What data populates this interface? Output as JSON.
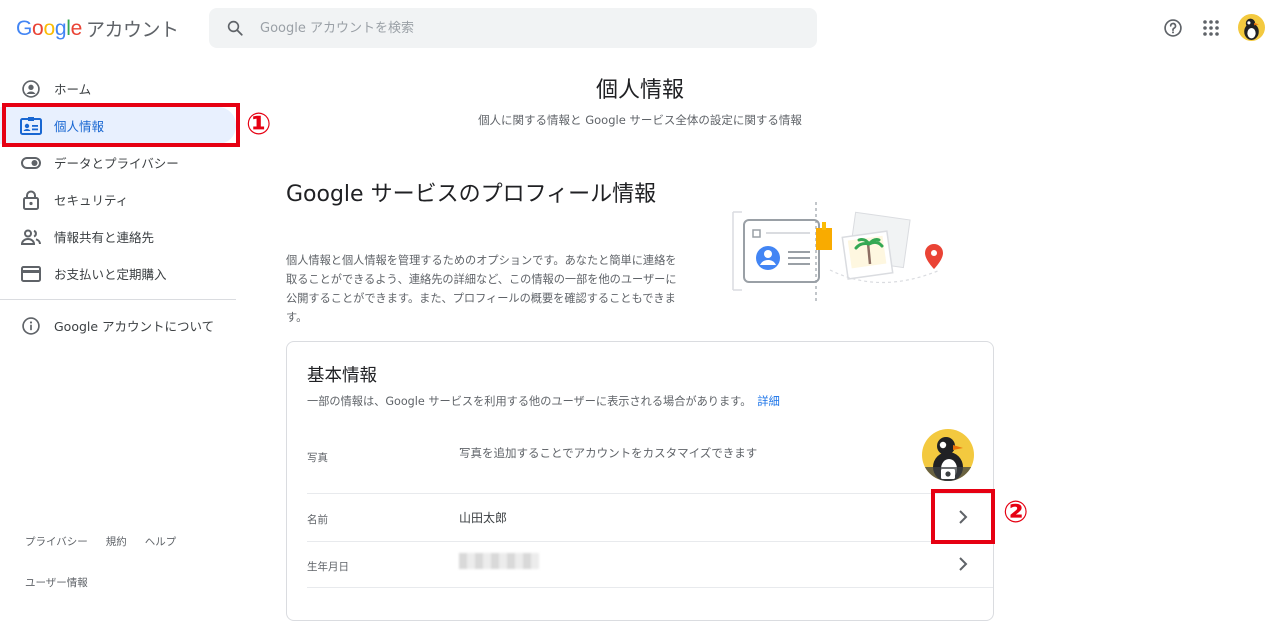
{
  "header": {
    "logo_google": "Google",
    "logo_account": "アカウント",
    "search_placeholder": "Google アカウントを検索"
  },
  "sidebar": {
    "items": [
      {
        "label": "ホーム",
        "icon": "account-circle-icon"
      },
      {
        "label": "個人情報",
        "icon": "badge-icon",
        "active": true
      },
      {
        "label": "データとプライバシー",
        "icon": "toggle-icon"
      },
      {
        "label": "セキュリティ",
        "icon": "lock-icon"
      },
      {
        "label": "情報共有と連絡先",
        "icon": "people-icon"
      },
      {
        "label": "お支払いと定期購入",
        "icon": "credit-card-icon"
      }
    ],
    "about": "Google アカウントについて",
    "footer_links": [
      "プライバシー",
      "規約",
      "ヘルプ"
    ],
    "footer_user": "ユーザー情報"
  },
  "main": {
    "title": "個人情報",
    "subtitle": "個人に関する情報と Google サービス全体の設定に関する情報",
    "section_title": "Google サービスのプロフィール情報",
    "section_desc": "個人情報と個人情報を管理するためのオプションです。あなたと簡単に連絡を取ることができるよう、連絡先の詳細など、この情報の一部を他のユーザーに公開することができます。また、プロフィールの概要を確認することもできます。",
    "card": {
      "title": "基本情報",
      "desc": "一部の情報は、Google サービスを利用する他のユーザーに表示される場合があります。",
      "desc_link": "詳細",
      "rows": [
        {
          "label": "写真",
          "value": "写真を追加することでアカウントをカスタマイズできます"
        },
        {
          "label": "名前",
          "value": "山田太郎"
        },
        {
          "label": "生年月日",
          "value": ""
        }
      ]
    }
  },
  "annotations": {
    "marker_1": "①",
    "marker_2": "②"
  },
  "colors": {
    "accent_blue": "#1a73e8",
    "active_bg": "#e8f0fe",
    "annotation_red": "#e60012"
  }
}
